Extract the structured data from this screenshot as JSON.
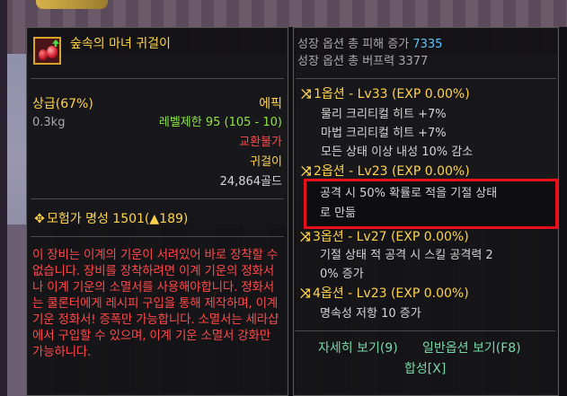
{
  "item": {
    "name": "숲속의 마녀 귀걸이",
    "grade_label": "상급(67%)",
    "rarity": "에픽",
    "weight": "0.3kg",
    "level_limit": "레벨제한 95 (105 - 10)",
    "trade": "교환불가",
    "type": "귀걸이",
    "price": "24,864골드",
    "fame": "모험가 명성 1501(▲189)",
    "description": "이 장비는 이계의 기운이 서려있어 바로 장착할 수 없습니다. 장비를 장착하려면 이계 기운의 정화서나 이계 기운의 소멸서를 사용해야합니다. 정화서는 쿨론터에게 레시피 구입을 통해 제작하며, 이계 기운 정화서! 증폭만 가능합니다. 소멸서는 세라샵에서 구입할 수 있으며, 이계 기운 소멸서 강화만 가능하니다."
  },
  "growth": {
    "damage_label": "성장 옵션 총 피해 증가",
    "damage_value": "7335",
    "buff_label": "성장 옵션 총 버프력 3377"
  },
  "options": [
    {
      "header": "1옵션 - Lv33 (EXP 0.00%)",
      "lines": [
        "물리 크리티컬 히트 +7%",
        "마법 크리티컬 히트 +7%",
        "모든 상태 이상 내성 10% 감소"
      ]
    },
    {
      "header": "2옵션 - Lv23 (EXP 0.00%)",
      "lines": [
        "공격 시 50% 확률로 적을 기절 상태",
        "로 만듦"
      ]
    },
    {
      "header": "3옵션 - Lv27 (EXP 0.00%)",
      "lines": [
        "기절 상태 적 공격 시 스킬 공격력 2",
        "0% 증가"
      ]
    },
    {
      "header": "4옵션 - Lv23 (EXP 0.00%)",
      "lines": [
        "명속성 저항 10 증가"
      ]
    }
  ],
  "footer": {
    "details": "자세히 보기(9)",
    "normal_options": "일반옵션 보기(F8)",
    "combine": "합성[X]"
  },
  "colors": {
    "gold": "#ffd44a",
    "epic": "#ffd44a",
    "green": "#8fe24a",
    "red": "#ff4a4a",
    "blue": "#55c8ff",
    "highlight": "#e8101a"
  },
  "icons": [
    "earring-item-icon",
    "shuffle-icon",
    "fame-emblem-icon"
  ]
}
